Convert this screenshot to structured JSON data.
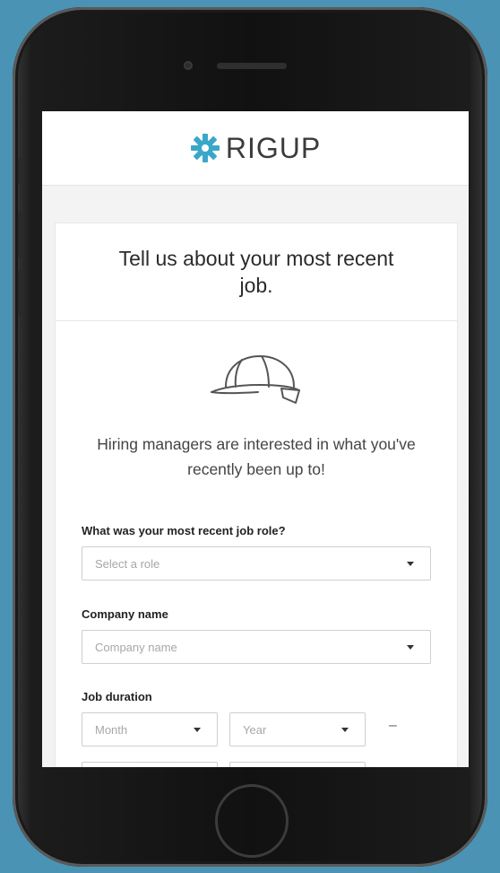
{
  "app": {
    "brand": "RIGUP"
  },
  "card": {
    "title": "Tell us about your most recent job.",
    "subtitle": "Hiring managers are interested in what you've recently been up to!"
  },
  "form": {
    "role_label": "What was your most recent job role?",
    "role_placeholder": "Select a role",
    "company_label": "Company name",
    "company_placeholder": "Company name",
    "duration_label": "Job duration",
    "start_month_placeholder": "Month",
    "start_year_placeholder": "Year",
    "separator": "–"
  },
  "icons": {
    "logo": "gear-logo-icon",
    "illustration": "hard-hat-icon",
    "dropdown": "chevron-down-icon"
  },
  "colors": {
    "background": "#4a93b4",
    "brand_accent": "#3aa7c9",
    "text": "#2b2b2b"
  }
}
